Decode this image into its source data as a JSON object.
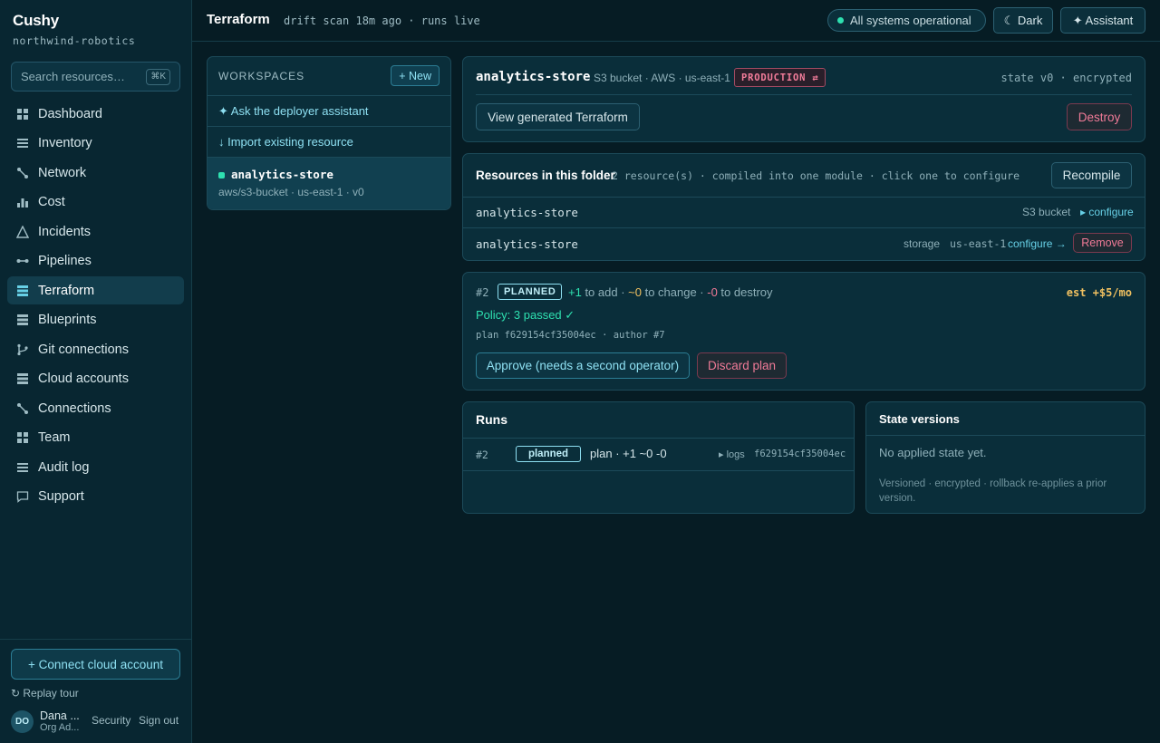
{
  "app": {
    "brand": "Cushy",
    "org": "northwind-robotics"
  },
  "search": {
    "placeholder": "Search resources…",
    "shortcut": "⌘K"
  },
  "nav": {
    "items": [
      {
        "label": "Dashboard",
        "icon": "grid-icon"
      },
      {
        "label": "Inventory",
        "icon": "list-icon"
      },
      {
        "label": "Network",
        "icon": "network-icon"
      },
      {
        "label": "Cost",
        "icon": "bar-chart-icon"
      },
      {
        "label": "Incidents",
        "icon": "warning-icon"
      },
      {
        "label": "Pipelines",
        "icon": "pipeline-icon"
      },
      {
        "label": "Terraform",
        "icon": "stack-icon",
        "active": true
      },
      {
        "label": "Blueprints",
        "icon": "stack-icon"
      },
      {
        "label": "Git connections",
        "icon": "git-branch-icon"
      },
      {
        "label": "Cloud accounts",
        "icon": "stack-icon"
      },
      {
        "label": "Connections",
        "icon": "network-icon"
      },
      {
        "label": "Team",
        "icon": "grid-icon"
      },
      {
        "label": "Audit log",
        "icon": "list-icon"
      },
      {
        "label": "Support",
        "icon": "chat-icon"
      }
    ]
  },
  "sidebar_footer": {
    "connect_label": "+ Connect cloud account",
    "replay_label": "↻ Replay tour",
    "avatar_initials": "DO",
    "user_name": "Dana ...",
    "user_role": "Org Ad...",
    "security_label": "Security",
    "signout_label": "Sign out"
  },
  "header": {
    "title": "Terraform",
    "subtitle": "drift scan 18m ago · runs live",
    "status": "All systems operational",
    "theme_label": "☾ Dark",
    "assistant_label": "✦ Assistant"
  },
  "workspaces": {
    "heading": "WORKSPACES",
    "new_label": "+ New",
    "ask_label": "✦ Ask the deployer assistant",
    "import_label": "↓ Import existing resource",
    "selected": {
      "name": "analytics-store",
      "meta": "aws/s3-bucket · us-east-1 · v0"
    }
  },
  "resource": {
    "name": "analytics-store",
    "meta": "S3 bucket · AWS · us-east-1",
    "badge": "PRODUCTION ⇄",
    "state": "state v0 · encrypted",
    "view_label": "View generated Terraform",
    "destroy_label": "Destroy"
  },
  "folder": {
    "title": "Resources in this folder",
    "subtitle": "2 resource(s) · compiled into one module · click one to configure",
    "recompile_label": "Recompile",
    "rows": [
      {
        "name": "analytics-store",
        "type": "S3 bucket",
        "configure": "▸ configure"
      },
      {
        "name": "analytics-store",
        "type": "storage",
        "region": "us-east-1",
        "configure": "configure →",
        "remove": "Remove"
      }
    ]
  },
  "plan": {
    "number": "#2",
    "status": "PLANNED",
    "add": "+1",
    "add_text": " to add · ",
    "change": "~0",
    "change_text": " to change · ",
    "destroy": "-0",
    "destroy_text": " to destroy",
    "estimate": "est +$5/mo",
    "policy": "Policy: 3 passed ✓",
    "meta": "plan f629154cf35004ec · author #7",
    "approve_label": "Approve (needs a second operator)",
    "discard_label": "Discard plan"
  },
  "runs": {
    "title": "Runs",
    "rows": [
      {
        "number": "#2",
        "status": "planned",
        "summary": "plan · +1 ~0 -0",
        "logs": "▸ logs",
        "hash": "f629154cf35004ec"
      }
    ]
  },
  "state_versions": {
    "title": "State versions",
    "empty": "No applied state yet.",
    "note": "Versioned · encrypted · rollback re-applies a prior version."
  },
  "colors": {
    "background": "#061c24",
    "accent": "#67d0e6",
    "success": "#2ee0b0",
    "danger": "#f07a97",
    "warning": "#f0c060"
  }
}
